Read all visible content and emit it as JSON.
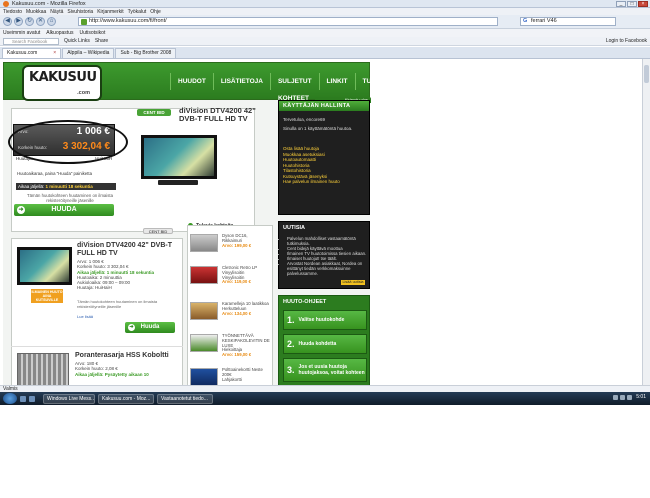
{
  "window": {
    "title": "Kakusuu.com - Mozilla Firefox"
  },
  "menu": [
    "Tiedosto",
    "Muokkaa",
    "Näytä",
    "Sivuhistoria",
    "Kirjanmerkit",
    "Työkalut",
    "Ohje"
  ],
  "address": {
    "url": "http://www.kakusuu.com/fi/front/"
  },
  "search": {
    "value": "ferrari V46"
  },
  "bookmarks1": [
    "Useimmin avatut",
    "Alkuopastus",
    "Uutisotsikot"
  ],
  "bookmarks2": {
    "search_placeholder": "Search Facebook",
    "quick_links": "Quick Links",
    "share": "Share",
    "login": "Login to Facebook"
  },
  "tabs": [
    {
      "label": "Kakusuu.com",
      "active": true
    },
    {
      "label": "Alppila – Wikipedia",
      "active": false
    },
    {
      "label": "Sub - Big Brother 2008",
      "active": false
    }
  ],
  "site": {
    "logo": "KAKUSUU",
    "logo_sub": ".com",
    "nav": [
      "HUUDOT",
      "LISÄTIETOJA",
      "SULJETUT KOHTEET",
      "LINKIT",
      "TUKI"
    ],
    "featured": {
      "badge": "CENT BID",
      "title": "diVision DTV4200 42\" DVB-T FULL HD TV",
      "arvo_label": "Arvo:",
      "arvo_value": "1 006 €",
      "korkein_label": "Korkein huuto:",
      "korkein_value": "3 302,04 €",
      "huutaja_label": "Huutaja:",
      "huutaja_value": "HuiHaiH",
      "line": "Huutoaikaraa, paina \"Huuda\" painiketta",
      "aika_label": "Aikaa jäljellä:",
      "aika_value": "1 minuutti 18 sekuntia",
      "note": "Tämän huutokohteen huutaminen on ilmaista rekisteröityneille jäsenille",
      "button": "HUUDA"
    },
    "kayttajan": {
      "toplink": "Kirjaudu ulos",
      "title": "KÄYTTÄJÄN HALLINTA",
      "welcome": "Tervetuloa, encore69",
      "balance": "Sinulla on 1 käyttämätöntä huutoa.",
      "links": [
        "Osta lisää huutoja",
        "Muokkaa asetuksiasi",
        "Huutoautomaatti",
        "Huutohistoria",
        "Tilastohistoria",
        "Kutsuystävä jäsenyksi",
        "Hae palvelun ilmainen huuto"
      ]
    },
    "uutisia": {
      "title": "UUTISIA",
      "items": [
        "Palvelun mahdolliset vastaamätöntä tutkimuksia.",
        "Cent bidejä käyttävä moottua",
        "Ilmainen TV huutotoimissa tiesien aikaan.",
        "Ilmaiset huutojut! tse täält.",
        "Arvostat Nordean asiakkaat, Nordea on esittänyt tiedän verkkomaksuinne palvelussamme."
      ],
      "more": "Lisää uutisia"
    },
    "ohjeet": {
      "title": "HUUTO-OHJEET",
      "steps": [
        {
          "n": "1.",
          "text": "Valitse huutokohde"
        },
        {
          "n": "2.",
          "text": "Huuda kohdetta"
        },
        {
          "n": "3.",
          "text": "Jos et uusia huutoja huutojaksoa, voitat kohteen"
        }
      ]
    },
    "list_badge": "CENT BID",
    "item1": {
      "title": "diVision DTV4200 42\" DVB-T FULL HD TV",
      "arvo": "Arvo: 1 006 €",
      "korkein": "Korkein huuto: 3 302,04 €",
      "aika": "Aikaa jäljellä: 1 minuutti 18 sekuntia",
      "huutoaika": "Huutoaika: 2 minuuttia",
      "aukiolo": "Aukioloaika: 09:00 – 09:00",
      "huutaja": "Huutaja: HuiHaiH",
      "badge": "ILMAINEN HUUTO AINA KUTSUVILLE",
      "note": "Tämän huutokohteen huutaminen on ilmaista rekisteröityneille jäsenille",
      "watch": "Lue lisää",
      "button": "Huuda"
    },
    "item2": {
      "title": "Poranterasarja HSS Koboltti",
      "arvo": "Arvo: 180 €",
      "korkein": "Korkein huuto: 2,08 €",
      "aika": "Aikaa jäljellä: Pysäytetty aikaan 10"
    },
    "upcoming": {
      "title": "Tulevia kohteita",
      "items": [
        {
          "name": "Dyson DC16,",
          "sub": "Rikkaimuri",
          "arvo": "Arvo: 199,00 €"
        },
        {
          "name": "Cletronic Retro LP Vinyylisoitin",
          "sub": "Vinyylisoitin",
          "arvo": "Arvo: 119,00 €"
        },
        {
          "name": "Karamelleja 10 laatikkoa",
          "sub": "Herkutteluun",
          "arvo": "Arvo: 134,00 €"
        },
        {
          "name": "TYÖNNETTÄVÄ KESKIPAKOLEVITIN DE LUXE",
          "sub": "Hiekoittaja",
          "arvo": "Arvo: 159,00 €"
        },
        {
          "name": "Polttoainekortti Neste 200€",
          "sub": "Lahjakortti",
          "arvo": ""
        }
      ]
    }
  },
  "status": "Valmis",
  "taskbar": {
    "items": [
      "Windows Live Mess...",
      "Kakusuu.com - Moz...",
      "Vastaanotetut tiedo..."
    ],
    "clock": "5:01"
  }
}
